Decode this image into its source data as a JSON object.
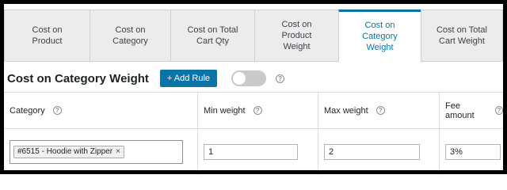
{
  "tabs": [
    {
      "label": "Cost on\nProduct",
      "active": false
    },
    {
      "label": "Cost on\nCategory",
      "active": false
    },
    {
      "label": "Cost on Total\nCart Qty",
      "active": false
    },
    {
      "label": "Cost on\nProduct\nWeight",
      "active": false
    },
    {
      "label": "Cost on\nCategory\nWeight",
      "active": true
    },
    {
      "label": "Cost on Total\nCart Weight",
      "active": false
    }
  ],
  "rule_bar": {
    "title": "Cost on Category Weight",
    "add_rule_label": "+ Add Rule",
    "toggle_on": false,
    "help_glyph": "?"
  },
  "table": {
    "headers": {
      "category": "Category",
      "min_weight": "Min weight",
      "max_weight": "Max weight",
      "fee_amount": "Fee amount"
    },
    "row": {
      "category_chip": "#6515 - Hoodie with Zipper",
      "chip_remove": "×",
      "min_weight": "1",
      "max_weight": "2",
      "fee_amount": "3%"
    }
  },
  "colors": {
    "accent": "#0a74a8",
    "tab_bg": "#ececec",
    "toggle_off": "#c9c9c9"
  }
}
